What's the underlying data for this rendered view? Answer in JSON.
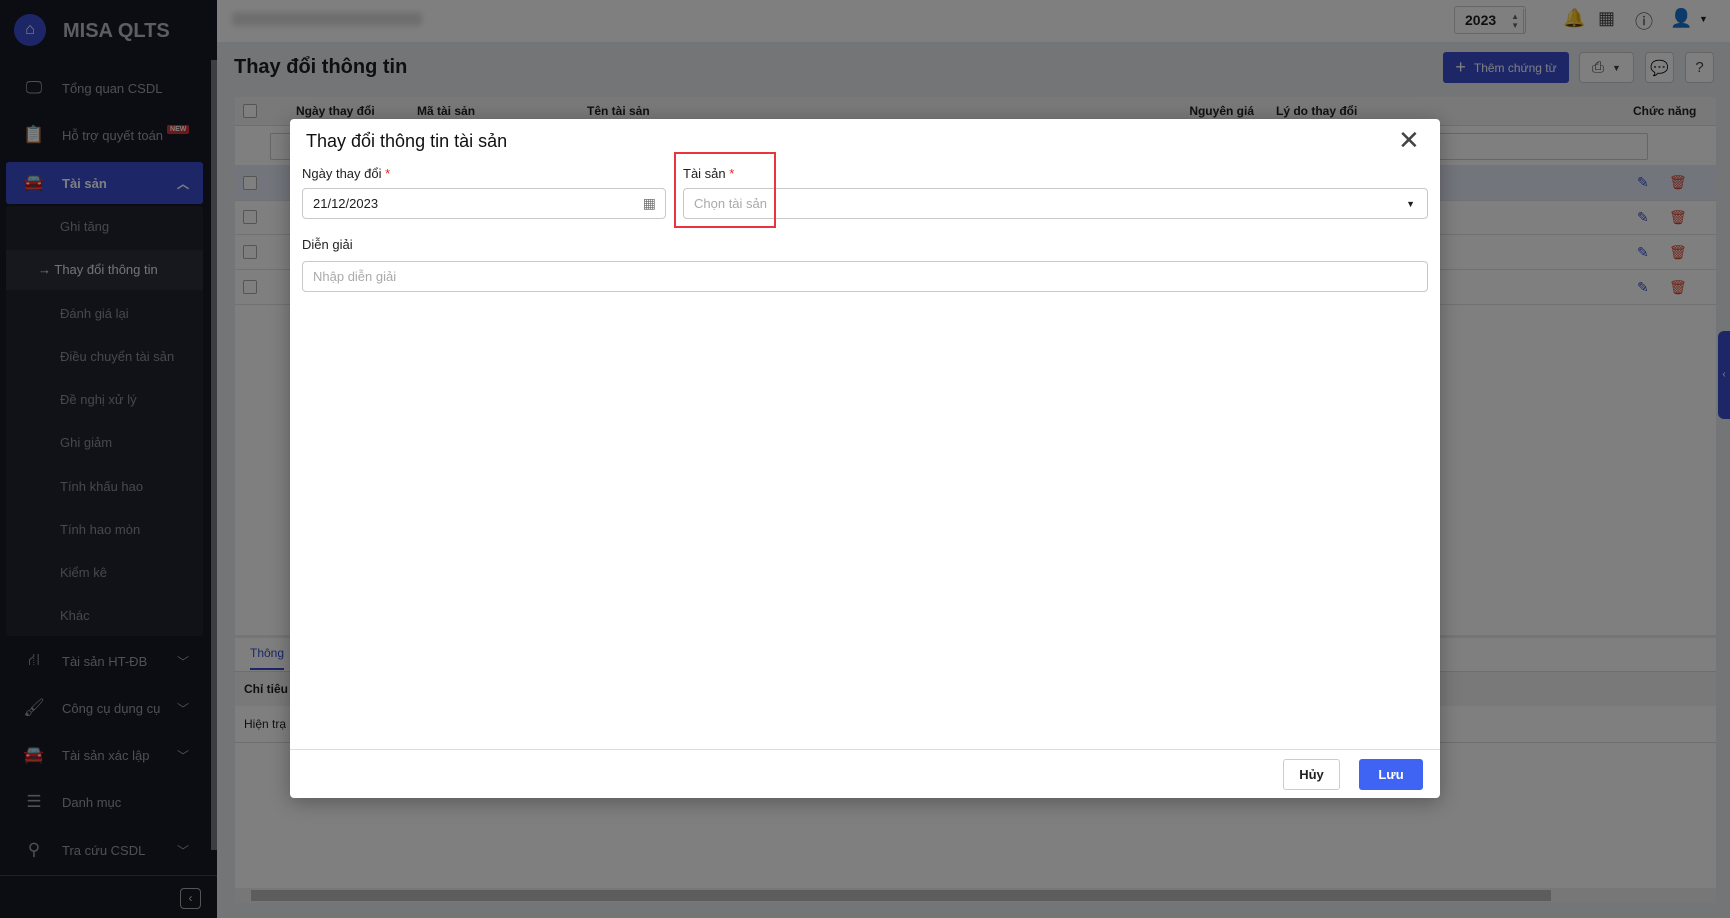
{
  "app": {
    "brand": "MISA QLTS",
    "logo_icon": "house-logo-icon"
  },
  "sidebar": {
    "items": [
      {
        "label": "Tổng quan CSDL",
        "icon": "monitor-chart-icon"
      },
      {
        "label": "Hỗ trợ quyết toán",
        "icon": "clipboard-check-icon",
        "badge": "NEW"
      },
      {
        "label": "Tài sản",
        "icon": "house-car-icon",
        "expanded": true
      },
      {
        "label": "Tài sản HT-ĐB",
        "icon": "road-icon"
      },
      {
        "label": "Công cụ dụng cụ",
        "icon": "paint-roller-icon"
      },
      {
        "label": "Tài sản xác lập",
        "icon": "house-car-icon"
      },
      {
        "label": "Danh mục",
        "icon": "list-icon"
      },
      {
        "label": "Tra cứu CSDL",
        "icon": "search-icon"
      }
    ],
    "submenu": [
      "Ghi tăng",
      "Thay đổi thông tin",
      "Đánh giá lại",
      "Điều chuyển tài sản",
      "Đề nghị xử lý",
      "Ghi giảm",
      "Tính khấu hao",
      "Tính hao mòn",
      "Kiểm kê",
      "Khác"
    ],
    "current_submenu": "Thay đổi thông tin"
  },
  "header": {
    "year": "2023"
  },
  "page": {
    "title": "Thay đổi thông tin",
    "add_button": "Thêm chứng từ",
    "table": {
      "columns": [
        "Ngày thay đổi",
        "Mã tài sản",
        "Tên tài sản",
        "Nguyên giá",
        "Lý do thay đổi",
        "Chức năng"
      ],
      "row_count": 4
    },
    "bottom": {
      "tab": "Thông",
      "header": "Chỉ tiêu",
      "row": "Hiện trạ"
    }
  },
  "dialog": {
    "title": "Thay đổi thông tin tài sản",
    "date_label": "Ngày thay đổi",
    "date_value": "21/12/2023",
    "asset_label": "Tài sản",
    "asset_placeholder": "Chọn tài sản",
    "desc_label": "Diễn giải",
    "desc_placeholder": "Nhập diễn giải",
    "required_mark": "*",
    "cancel": "Hủy",
    "save": "Lưu"
  },
  "colors": {
    "accent": "#3a4ecf",
    "save": "#3f63f2",
    "highlight": "#e8353b"
  }
}
